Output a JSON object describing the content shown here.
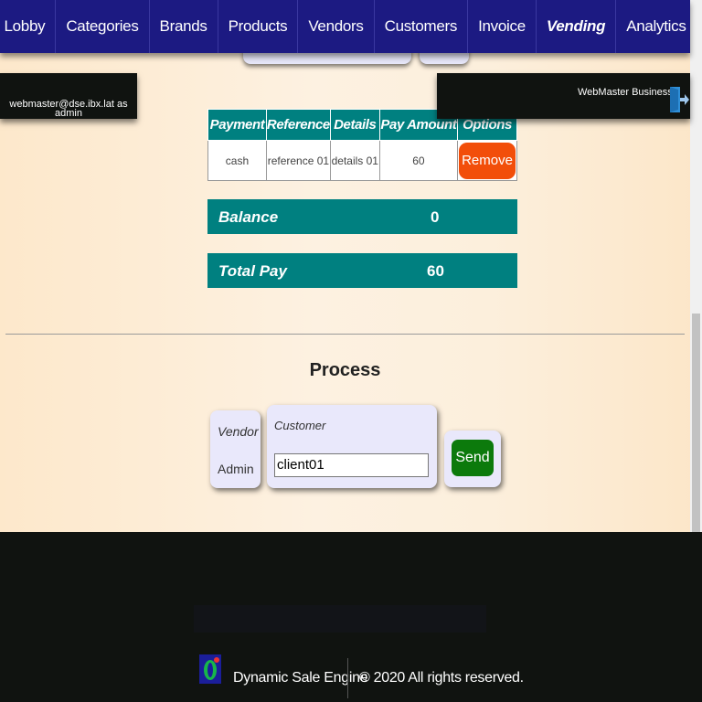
{
  "nav": {
    "items": [
      {
        "label": "Lobby"
      },
      {
        "label": "Categories"
      },
      {
        "label": "Brands"
      },
      {
        "label": "Products"
      },
      {
        "label": "Vendors"
      },
      {
        "label": "Customers"
      },
      {
        "label": "Invoice"
      },
      {
        "label": "Vending",
        "active": true
      },
      {
        "label": "Analytics"
      }
    ]
  },
  "user": {
    "session_text": "webmaster@dse.ibx.lat as admin"
  },
  "business": {
    "name": "WebMaster Business",
    "logout_icon": "logout-icon"
  },
  "payments": {
    "headers": [
      "Payment",
      "Reference",
      "Details",
      "Pay Amount",
      "Options"
    ],
    "rows": [
      {
        "payment": "cash",
        "reference": "reference 01",
        "details": "details 01",
        "amount": "60",
        "action": "Remove"
      }
    ]
  },
  "summary": {
    "balance_label": "Balance",
    "balance_value": "0",
    "total_label": "Total Pay",
    "total_value": "60"
  },
  "process": {
    "title": "Process",
    "vendor_label": "Vendor",
    "vendor_value": "Admin",
    "customer_label": "Customer",
    "customer_value": "client01",
    "send_label": "Send"
  },
  "footer": {
    "brand": "Dynamic Sale Engine",
    "copyright": "© 2020 All rights reserved."
  },
  "colors": {
    "nav_bg": "#1c1a82",
    "teal": "#008080",
    "remove": "#f24e0a",
    "send": "#0c7a0c",
    "footer_bg": "#101310"
  }
}
